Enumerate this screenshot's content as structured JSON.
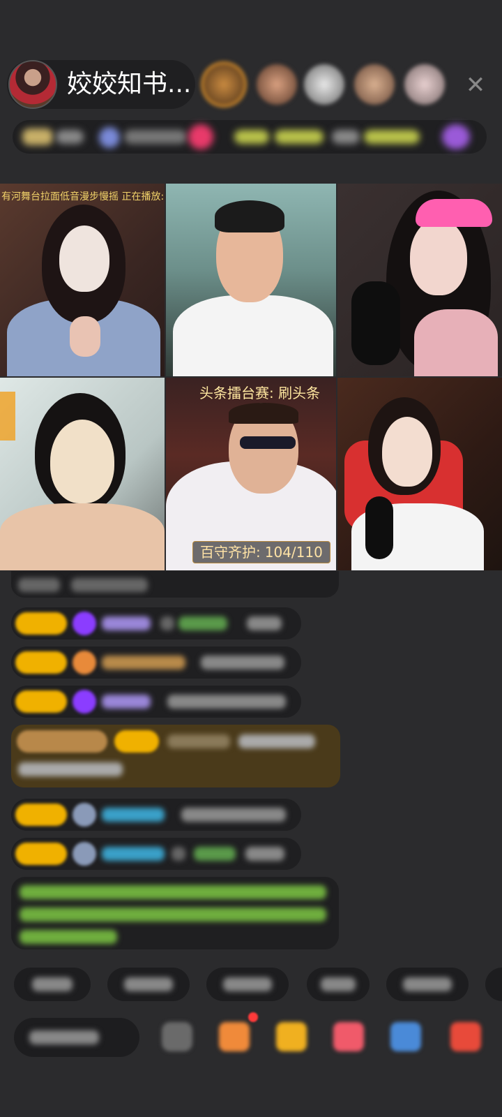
{
  "host": {
    "name": "姣姣知书..."
  },
  "video_tiles": {
    "tile_1_caption": "有河舞台拉面低音漫步慢摇 正在播放: 未知",
    "tile_5_caption": "头条擂台赛: 刷头条",
    "guard": {
      "label": "百守齐护:",
      "count": "104/110"
    }
  },
  "colors": {
    "background": "#2b2b2d",
    "chat_bubble": "#1f1f21",
    "badge_gold": "#f0b100",
    "gem_purple": "#8b3dff",
    "highlight_row": "#4a3a1a",
    "username_teal": "#3aa0c8",
    "system_green": "#7ac43c"
  },
  "icons": [
    "close-icon",
    "gift-icon",
    "treasure-icon",
    "red-packet-icon",
    "game-icon",
    "share-icon",
    "emoji-icon"
  ]
}
